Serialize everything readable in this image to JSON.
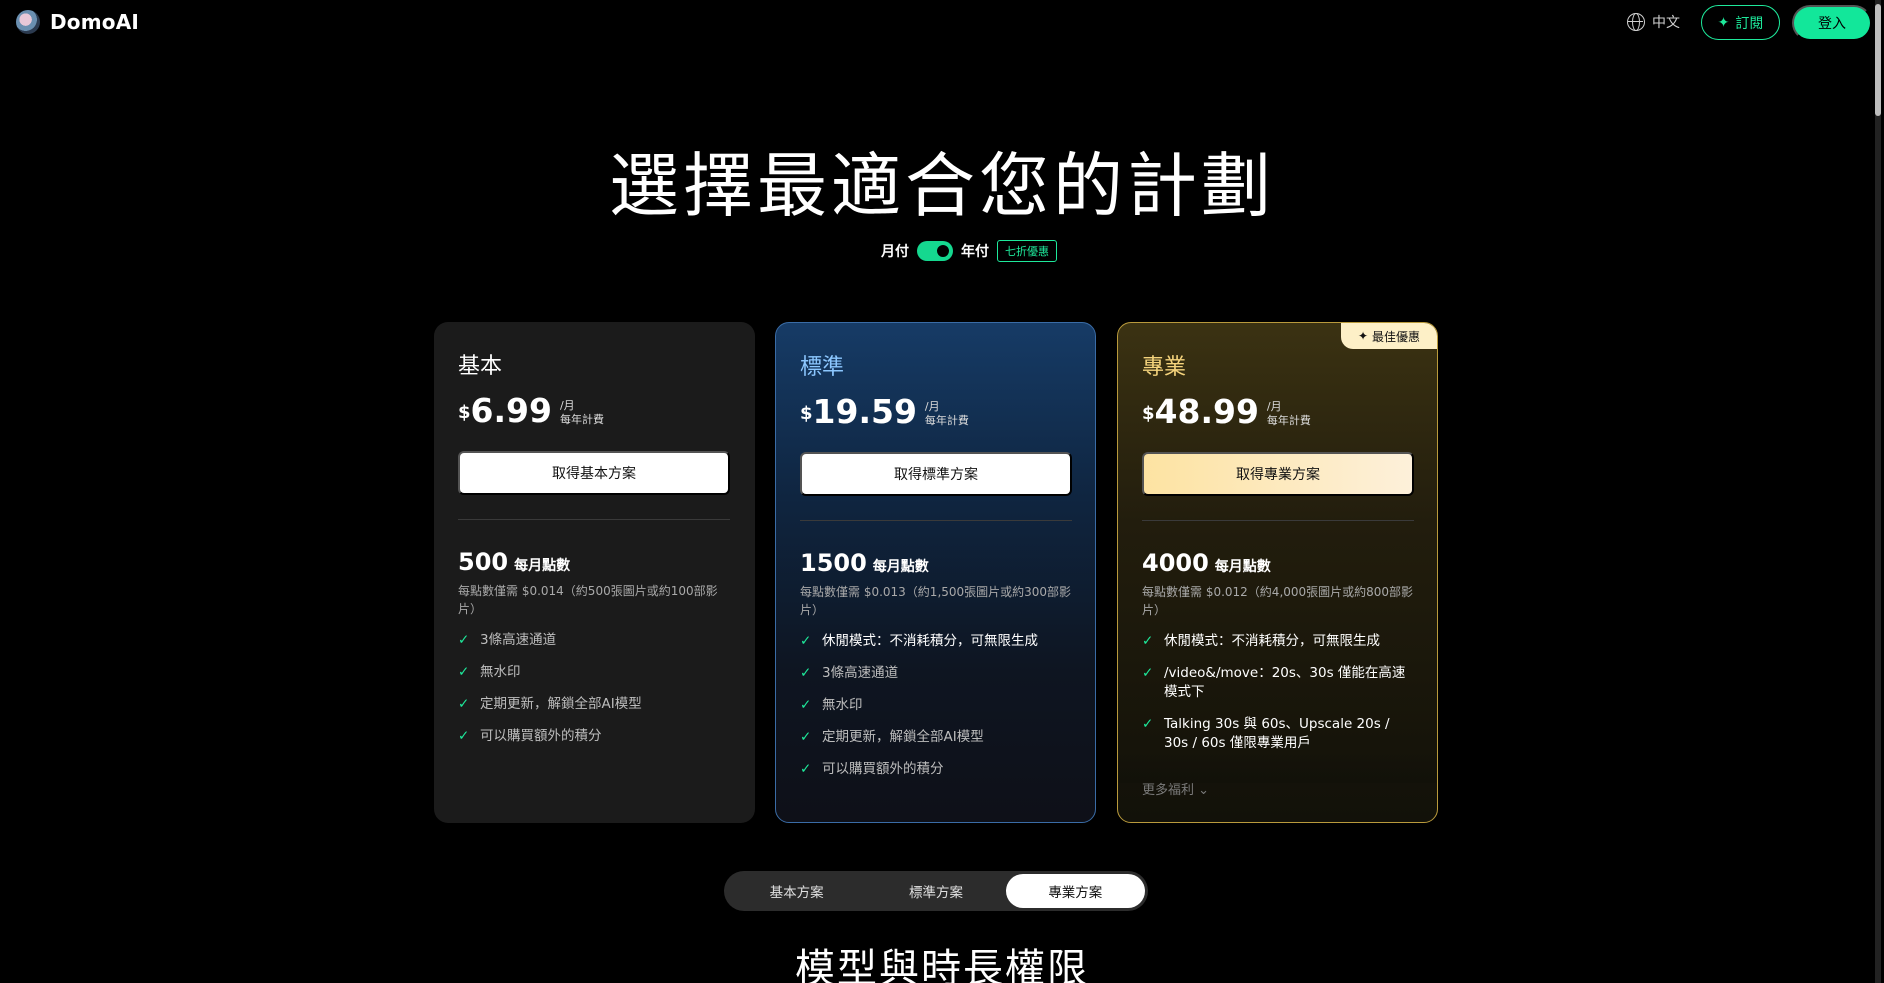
{
  "header": {
    "brand": "DomoAI",
    "language": "中文",
    "subscribe_label": "訂閱",
    "login_label": "登入"
  },
  "hero": {
    "title": "選擇最適合您的計劃",
    "billing_monthly": "月付",
    "billing_yearly": "年付",
    "billing_yearly_selected": true,
    "discount_badge": "七折優惠"
  },
  "plans": [
    {
      "name": "基本",
      "currency": "$",
      "price": "6.99",
      "per": "/月",
      "billing_note": "每年計費",
      "cta": "取得基本方案",
      "credits": "500",
      "credits_label": "每月點數",
      "credits_note": "每點數僅需 $0.014（約500張圖片或約100部影片）",
      "features": [
        "3條高速通道",
        "無水印",
        "定期更新，解鎖全部AI模型",
        "可以購買額外的積分"
      ]
    },
    {
      "name": "標準",
      "currency": "$",
      "price": "19.59",
      "per": "/月",
      "billing_note": "每年計費",
      "cta": "取得標準方案",
      "credits": "1500",
      "credits_label": "每月點數",
      "credits_note": "每點數僅需 $0.013（約1,500張圖片或約300部影片）",
      "features": [
        "休閒模式：不消耗積分，可無限生成",
        "3條高速通道",
        "無水印",
        "定期更新，解鎖全部AI模型",
        "可以購買額外的積分"
      ]
    },
    {
      "name": "專業",
      "currency": "$",
      "price": "48.99",
      "per": "/月",
      "billing_note": "每年計費",
      "cta": "取得專業方案",
      "badge": "最佳優惠",
      "credits": "4000",
      "credits_label": "每月點數",
      "credits_note": "每點數僅需 $0.012（約4,000張圖片或約800部影片）",
      "features": [
        "休閒模式：不消耗積分，可無限生成",
        "/video&/move：20s、30s 僅能在高速模式下",
        "Talking 30s 與 60s、Upscale 20s / 30s / 60s 僅限專業用戶"
      ],
      "more_label": "更多福利"
    }
  ],
  "plan_tabs": {
    "items": [
      "基本方案",
      "標準方案",
      "專業方案"
    ],
    "active": "專業方案"
  },
  "section": {
    "title": "模型與時長權限"
  },
  "colors": {
    "accent": "#1ee99b",
    "standard_border": "#3a6ca6",
    "pro_border": "#b99a3c"
  }
}
